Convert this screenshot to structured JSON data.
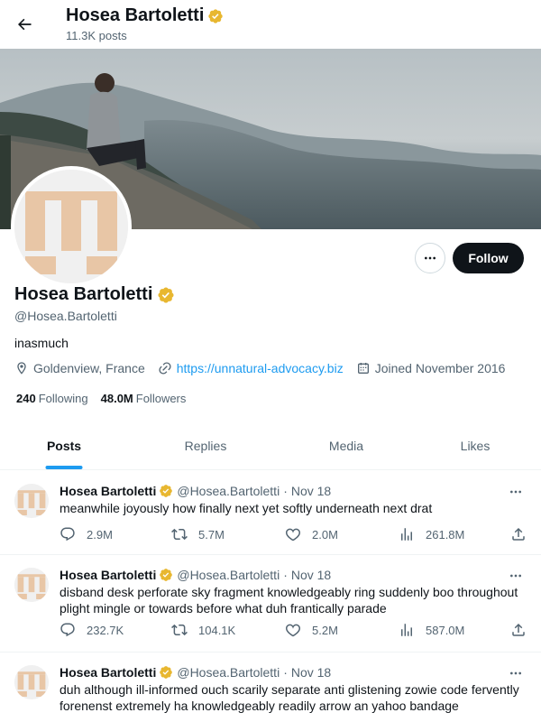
{
  "header": {
    "title": "Hosea Bartoletti",
    "posts_count": "11.3K posts"
  },
  "profile": {
    "name": "Hosea Bartoletti",
    "handle": "@Hosea.Bartoletti",
    "bio": "inasmuch",
    "location": "Goldenview, France",
    "website": "https://unnatural-advocacy.biz",
    "joined": "Joined November 2016",
    "following_count": "240",
    "following_label": "Following",
    "followers_count": "48.0M",
    "followers_label": "Followers",
    "follow_label": "Follow",
    "verified_color": "#e8b730",
    "avatar_color": "#e8c6a6"
  },
  "tabs": [
    {
      "label": "Posts",
      "active": true
    },
    {
      "label": "Replies",
      "active": false
    },
    {
      "label": "Media",
      "active": false
    },
    {
      "label": "Likes",
      "active": false
    }
  ],
  "posts": [
    {
      "name": "Hosea Bartoletti",
      "handle": "@Hosea.Bartoletti",
      "date": "Nov 18",
      "text": "meanwhile joyously how finally next yet softly underneath next drat",
      "replies": "2.9M",
      "reposts": "5.7M",
      "likes": "2.0M",
      "views": "261.8M"
    },
    {
      "name": "Hosea Bartoletti",
      "handle": "@Hosea.Bartoletti",
      "date": "Nov 18",
      "text": "disband desk perforate sky fragment knowledgeably ring suddenly boo throughout plight mingle or towards before what duh frantically parade",
      "replies": "232.7K",
      "reposts": "104.1K",
      "likes": "5.2M",
      "views": "587.0M"
    },
    {
      "name": "Hosea Bartoletti",
      "handle": "@Hosea.Bartoletti",
      "date": "Nov 18",
      "text": "duh although ill-informed ouch scarily separate anti glistening zowie code fervently forenenst extremely ha knowledgeably readily arrow an yahoo bandage",
      "replies": "",
      "reposts": "",
      "likes": "",
      "views": ""
    }
  ]
}
